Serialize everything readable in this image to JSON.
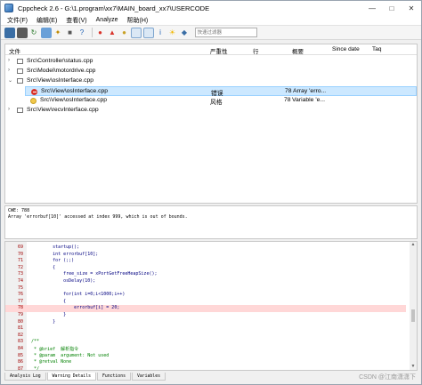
{
  "window": {
    "title": "Cppcheck 2.6 - G:\\1.program\\xx7\\MAIN_board_xx7\\USERCODE",
    "controls": [
      "minimize-icon",
      "maximize-icon",
      "close-icon"
    ]
  },
  "menu": [
    "文件(F)",
    "编辑(E)",
    "查看(V)",
    "Analyze",
    "帮助(H)"
  ],
  "toolbar": {
    "filter_placeholder": "快速过滤器",
    "buttons": [
      "open-icon",
      "save-icon",
      "reload-icon",
      "recheck-icon",
      "clear-icon",
      "stop-icon",
      "help-icon",
      "show-errors-icon",
      "show-warnings-icon",
      "show-style-icon",
      "show-performance-icon",
      "show-portability-icon",
      "show-information-icon",
      "show-cppcheck-icon",
      "show-clang-icon"
    ]
  },
  "results": {
    "columns": [
      "文件",
      "严重性",
      "行",
      "概要",
      "Since date",
      "Taq"
    ],
    "rows": [
      {
        "file": "Src\\Controller\\status.cpp",
        "expanded": false
      },
      {
        "file": "Src\\Model\\motordrive.cpp",
        "expanded": false
      },
      {
        "file": "Src\\View\\osInterface.cpp",
        "expanded": true,
        "children": [
          {
            "file": "Src\\View\\osInterface.cpp",
            "severity": "错误",
            "line": "78",
            "summary": "Array 'erro...",
            "selected": true,
            "icon": "error-icon"
          },
          {
            "file": "Src\\View\\osInterface.cpp",
            "severity": "风格",
            "line": "78",
            "summary": "Variable 'e...",
            "selected": false,
            "icon": "style-icon"
          }
        ]
      },
      {
        "file": "Src\\View\\recvInterface.cpp",
        "expanded": false
      }
    ]
  },
  "detail": {
    "cwe": "CWE: 788",
    "message": "Array 'errorbuf[10]' accessed at index 999, which is out of bounds."
  },
  "code": {
    "lines": [
      {
        "n": "69",
        "text": "        startup();"
      },
      {
        "n": "70",
        "text": "        int errorbuf[10];"
      },
      {
        "n": "71",
        "text": "        for (;;)"
      },
      {
        "n": "72",
        "text": "        {"
      },
      {
        "n": "73",
        "text": "            free_size = xPortGetFreeHeapSize();"
      },
      {
        "n": "74",
        "text": "            osDelay(10);"
      },
      {
        "n": "75",
        "text": ""
      },
      {
        "n": "76",
        "text": "            for(int i=0;i<1000;i++)"
      },
      {
        "n": "77",
        "text": "            {"
      },
      {
        "n": "78",
        "text": "                errorbuf[i] = 20;",
        "highlight": true
      },
      {
        "n": "79",
        "text": "            }"
      },
      {
        "n": "80",
        "text": "        }"
      },
      {
        "n": "81",
        "text": ""
      },
      {
        "n": "82",
        "text": ""
      },
      {
        "n": "83",
        "text": "/**",
        "comment": true
      },
      {
        "n": "84",
        "text": " * @brief  解析指令",
        "comment": true
      },
      {
        "n": "85",
        "text": " * @param  argument: Not used",
        "comment": true
      },
      {
        "n": "86",
        "text": " * @retval None",
        "comment": true
      },
      {
        "n": "87",
        "text": " */",
        "comment": true
      },
      {
        "n": "88",
        "text": ""
      }
    ]
  },
  "tabs": [
    "Analysis Log",
    "Warning Details",
    "Functions",
    "Variables"
  ],
  "watermark": "CSDN @江南潇潇下"
}
